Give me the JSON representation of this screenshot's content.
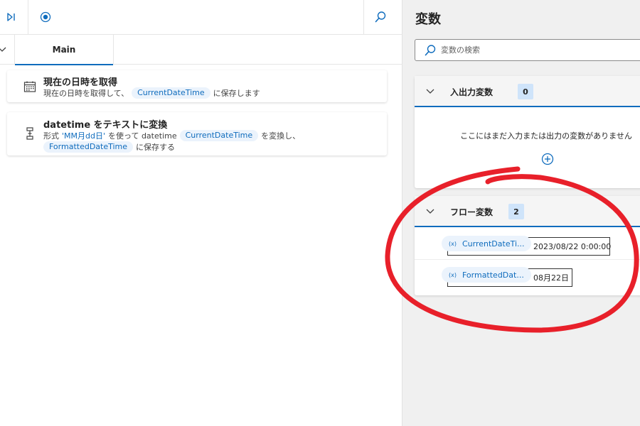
{
  "left_pane": {
    "tab": "Main",
    "actions": [
      {
        "title": "現在の日時を取得",
        "desc_pre": "現在の日時を取得して、",
        "chip": "CurrentDateTime",
        "desc_post": "に保存します"
      },
      {
        "title": "datetime をテキストに変換",
        "line1_pre": "形式",
        "format": "'MM月dd日'",
        "line1_mid": "を使って datetime",
        "chip1": "CurrentDateTime",
        "line1_post": "を変換し、",
        "chip2": "FormattedDateTime",
        "line2_post": "に保存する"
      }
    ]
  },
  "right_pane": {
    "title": "変数",
    "search_placeholder": "変数の検索",
    "io_section": {
      "title": "入出力変数",
      "count": "0",
      "empty_message": "ここにはまだ入力または出力の変数がありません"
    },
    "flow_section": {
      "title": "フロー変数",
      "count": "2",
      "variables": [
        {
          "prefix": "(x)",
          "name": "CurrentDateTi...",
          "value": "2023/08/22 0:00:00"
        },
        {
          "prefix": "(x)",
          "name": "FormattedDat...",
          "value": "08月22日"
        }
      ]
    }
  },
  "colors": {
    "accent": "#0f6cbd",
    "chip_bg": "#ebf3fc",
    "count_bg": "#cfe4fa",
    "annotation": "#e8202a"
  },
  "icons": [
    "step-over-icon",
    "record-icon",
    "search-icon",
    "calendar-icon",
    "convert-icon",
    "chevron-down-icon",
    "add-circle-icon"
  ]
}
